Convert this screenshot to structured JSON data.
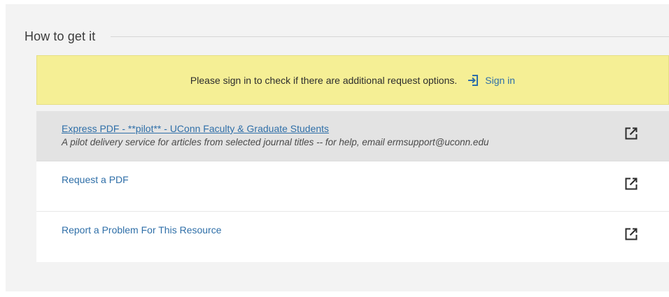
{
  "section": {
    "title": "How to get it"
  },
  "banner": {
    "message": "Please sign in to check if there are additional request options.",
    "signin_label": "Sign in",
    "signin_icon": "sign-in-icon"
  },
  "links": [
    {
      "label": "Express PDF - **pilot** - UConn Faculty & Graduate Students",
      "description": "A pilot delivery service for articles from selected journal titles -- for help, email ermsupport@uconn.edu",
      "icon": "external-link-icon"
    },
    {
      "label": "Request a PDF",
      "icon": "external-link-icon"
    },
    {
      "label": "Report a Problem For This Resource",
      "icon": "external-link-icon"
    }
  ],
  "colors": {
    "banner_background": "#f5ef95",
    "link": "#2f6fa8",
    "panel_background": "#f3f3f3",
    "active_row_background": "#e3e3e3"
  }
}
